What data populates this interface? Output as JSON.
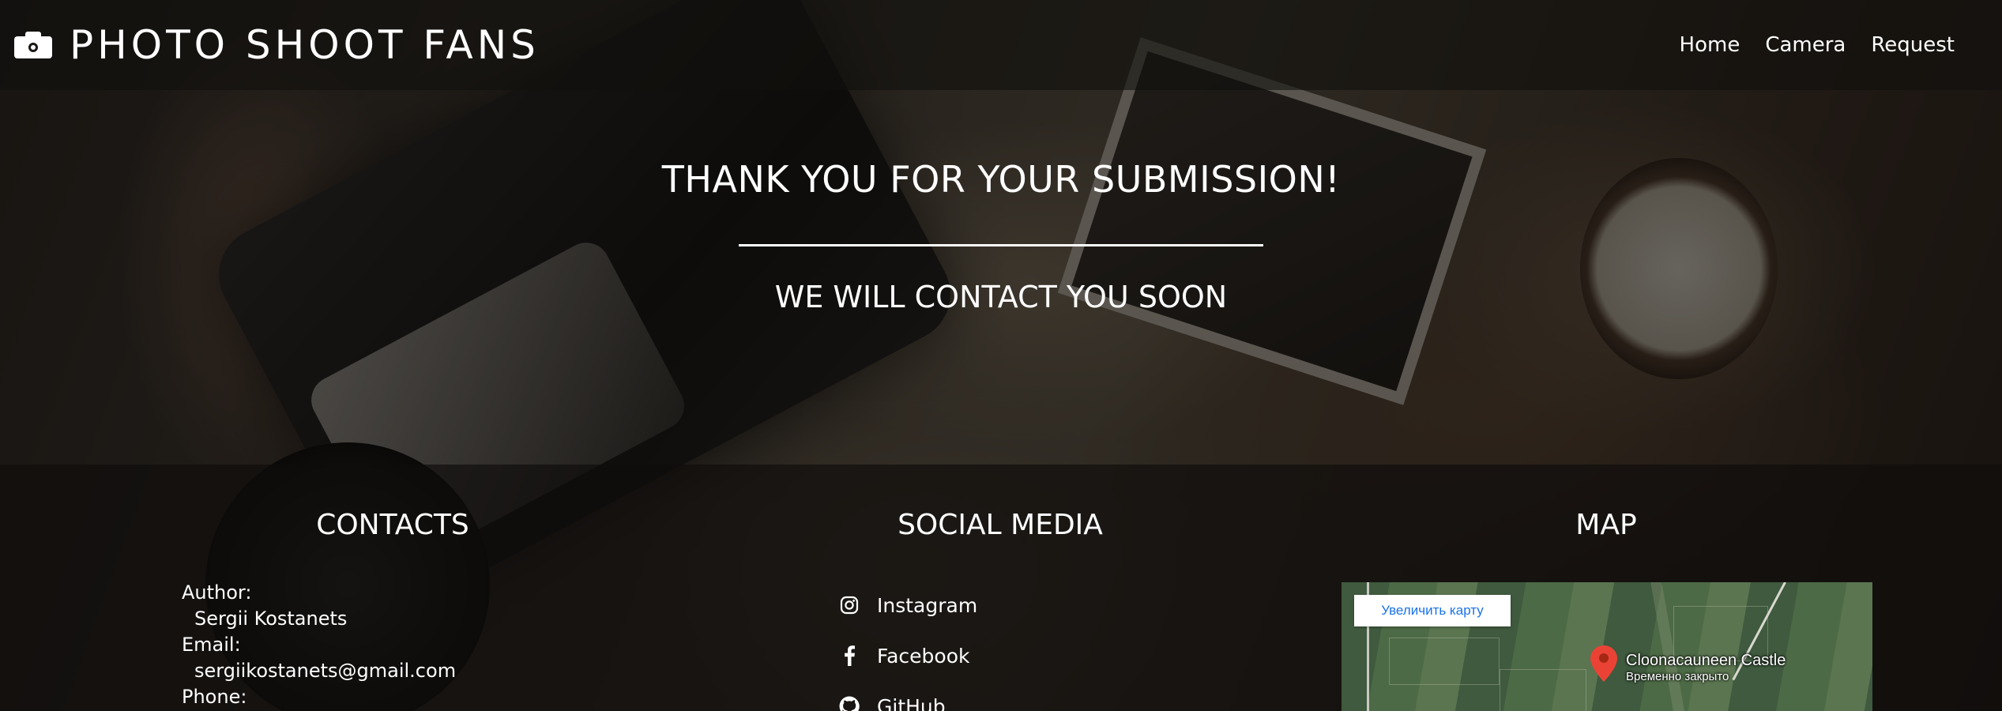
{
  "header": {
    "brand_icon": "camera-icon",
    "brand_title": "PHOTO SHOOT FANS",
    "nav": [
      {
        "label": "Home"
      },
      {
        "label": "Camera"
      },
      {
        "label": "Request"
      }
    ]
  },
  "hero": {
    "title": "THANK YOU FOR YOUR SUBMISSION!",
    "subtitle": "WE WILL CONTACT YOU SOON"
  },
  "footer": {
    "contacts": {
      "title": "CONTACTS",
      "author_label": "Author:",
      "author_value": "Sergii Kostanets",
      "email_label": "Email:",
      "email_value": "sergiikostanets@gmail.com",
      "phone_label": "Phone:"
    },
    "social": {
      "title": "SOCIAL MEDIA",
      "items": [
        {
          "label": "Instagram",
          "icon": "instagram-icon"
        },
        {
          "label": "Facebook",
          "icon": "facebook-icon"
        },
        {
          "label": "GitHub",
          "icon": "github-icon"
        }
      ]
    },
    "map": {
      "title": "MAP",
      "enlarge_button": "Увеличить карту",
      "place_name": "Cloonacauneen Castle",
      "place_status": "Временно закрыто",
      "pin_color": "#ea4335"
    }
  }
}
